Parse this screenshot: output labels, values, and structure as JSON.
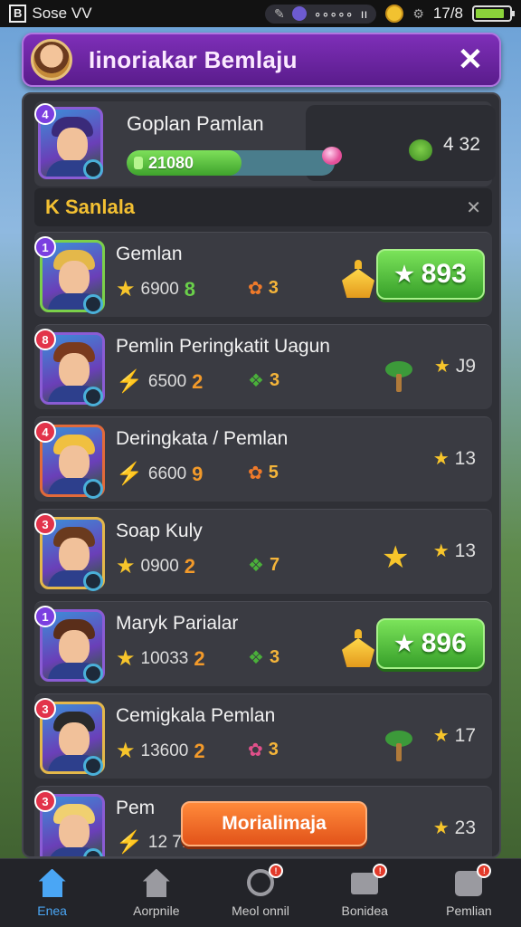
{
  "status_bar": {
    "box_label": "B",
    "app_label": "Sose VV",
    "pill_text": "∘∘∘∘∘",
    "signal": "ıı",
    "time": "17/8"
  },
  "header": {
    "title": "Iinoriakar Bemlaju",
    "close_label": "✕"
  },
  "me": {
    "name": "Goplan Pamlan",
    "bar_value": "21080",
    "bar_fill": 0.55,
    "score": "4 32",
    "rank": "4"
  },
  "section": {
    "title": "K Sanlala",
    "icon": "✕"
  },
  "rows": [
    {
      "rank": "1",
      "rank_color": "#7b3fe0",
      "avatar_border": "#7bd04a",
      "hair": "#e4b84a",
      "name": "Gemlan",
      "points": "6900",
      "points_icon": "star-icon",
      "level": "8",
      "level_color": "#6ad04a",
      "gem_count": "3",
      "gem_icon": "flower-icon",
      "right_type": "button",
      "button_value": "893"
    },
    {
      "rank": "8",
      "rank_color": "#e2334a",
      "avatar_border": "#8a5cd4",
      "hair": "#7a3a1e",
      "name": "Pemlin Peringkatit Uagun",
      "points": "6500",
      "points_icon": "bolt-icon",
      "level": "2",
      "level_color": "#f39a2a",
      "gem_count": "3",
      "gem_icon": "leaf-icon",
      "right_type": "score",
      "score": "J9"
    },
    {
      "rank": "4",
      "rank_color": "#e2334a",
      "avatar_border": "#e26a3a",
      "hair": "#f0c040",
      "name": "Deringkata / Pemlan",
      "points": "6600",
      "points_icon": "bolt-icon",
      "level": "9",
      "level_color": "#f39a2a",
      "gem_count": "5",
      "gem_icon": "flower-icon",
      "right_type": "score",
      "score": "13"
    },
    {
      "rank": "3",
      "rank_color": "#e2334a",
      "avatar_border": "#e4b84a",
      "hair": "#6a3a1e",
      "name": "Soap Kuly",
      "points": "0900",
      "points_icon": "star-icon",
      "level": "2",
      "level_color": "#f39a2a",
      "gem_count": "7",
      "gem_icon": "leaf-icon",
      "right_type": "score",
      "score": "13"
    },
    {
      "rank": "1",
      "rank_color": "#7b3fe0",
      "avatar_border": "#8a5cd4",
      "hair": "#5a2e1a",
      "name": "Maryk Parialar",
      "points": "10033",
      "points_icon": "star-icon",
      "level": "2",
      "level_color": "#f39a2a",
      "gem_count": "3",
      "gem_icon": "leaf-icon",
      "right_type": "button",
      "button_value": "896"
    },
    {
      "rank": "3",
      "rank_color": "#e2334a",
      "avatar_border": "#e4b84a",
      "hair": "#2a2a2a",
      "name": "Cemigkala Pemlan",
      "points": "13600",
      "points_icon": "star-icon",
      "level": "2",
      "level_color": "#f39a2a",
      "gem_count": "3",
      "gem_icon": "pink-flower-icon",
      "right_type": "score",
      "score": "17"
    },
    {
      "rank": "3",
      "rank_color": "#e2334a",
      "avatar_border": "#8a5cd4",
      "hair": "#f0d070",
      "name": "Pem",
      "points": "12 7.0",
      "points_icon": "bolt-icon",
      "level": "",
      "level_color": "#f39a2a",
      "gem_count": "",
      "gem_icon": "",
      "right_type": "score",
      "score": "23",
      "cta_label": "Morialimaja"
    }
  ],
  "nav": [
    {
      "label": "Enea",
      "icon": "home-icon",
      "active": true,
      "badge": false
    },
    {
      "label": "Aorpnile",
      "icon": "house-icon",
      "active": false,
      "badge": false
    },
    {
      "label": "Meol onnil",
      "icon": "clock-icon",
      "active": false,
      "badge": true
    },
    {
      "label": "Bonidea",
      "icon": "mail-icon",
      "active": false,
      "badge": true
    },
    {
      "label": "Pemlian",
      "icon": "list-icon",
      "active": false,
      "badge": true
    }
  ],
  "colors": {
    "header": "#6a27a4",
    "accent_green": "#4fc03a",
    "accent_orange": "#f05a20",
    "gold": "#f3c032"
  }
}
